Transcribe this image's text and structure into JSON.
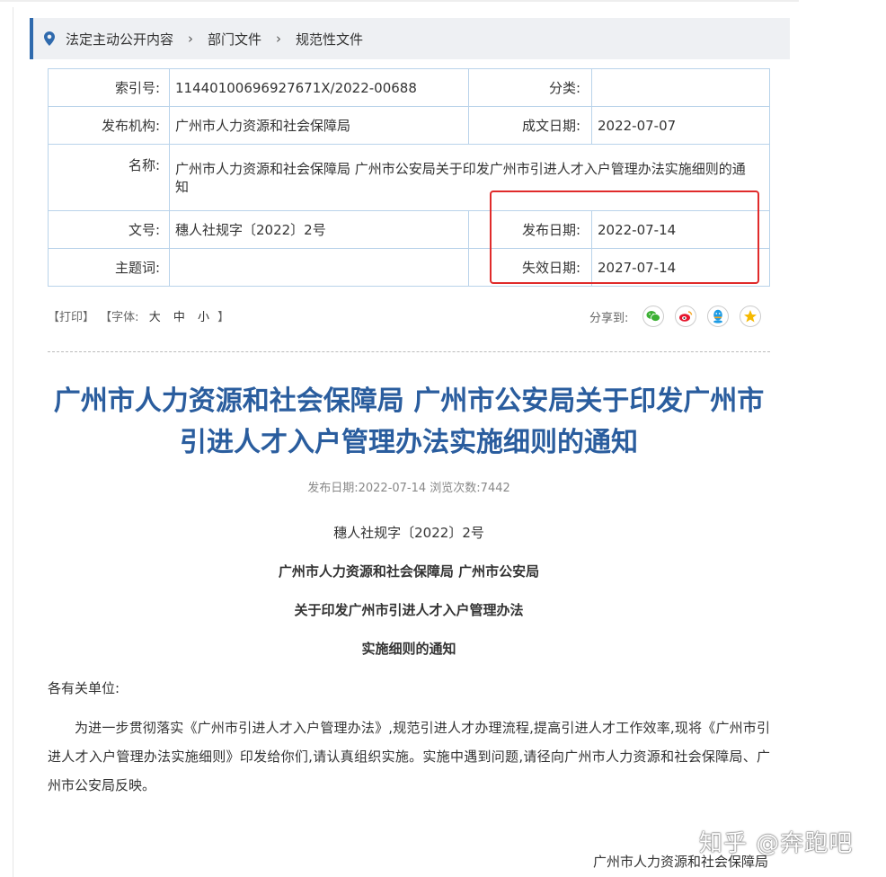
{
  "breadcrumb": [
    "法定主动公开内容",
    "部门文件",
    "规范性文件"
  ],
  "info": {
    "index_label": "索引号:",
    "index_value": "11440100696927671X/2022-00688",
    "category_label": "分类:",
    "category_value": "",
    "publisher_label": "发布机构:",
    "publisher_value": "广州市人力资源和社会保障局",
    "created_label": "成文日期:",
    "created_value": "2022-07-07",
    "name_label": "名称:",
    "name_value": "广州市人力资源和社会保障局 广州市公安局关于印发广州市引进人才入户管理办法实施细则的通知",
    "docno_label": "文号:",
    "docno_value": "穗人社规字〔2022〕2号",
    "pubdate_label": "发布日期:",
    "pubdate_value": "2022-07-14",
    "subject_label": "主题词:",
    "subject_value": "",
    "expire_label": "失效日期:",
    "expire_value": "2027-07-14"
  },
  "tools": {
    "print": "【打印】",
    "font_open": "【字体:",
    "large": "大",
    "medium": "中",
    "small": "小",
    "font_close": "】",
    "share_label": "分享到:"
  },
  "share_icons": [
    "wechat-icon",
    "weibo-icon",
    "qq-icon",
    "qzone-icon"
  ],
  "colors": {
    "accent": "#2f6aad",
    "title": "#2a5d9e",
    "table_border": "#b9d3ea",
    "highlight": "#e02b2b"
  },
  "article": {
    "title": "广州市人力资源和社会保障局 广州市公安局关于印发广州市引进人才入户管理办法实施细则的通知",
    "meta": "发布日期:2022-07-14  浏览次数:7442",
    "doc_number": "穗人社规字〔2022〕2号",
    "heading1": "广州市人力资源和社会保障局  广州市公安局",
    "heading2": "关于印发广州市引进人才入户管理办法",
    "heading3": "实施细则的通知",
    "salutation": "各有关单位:",
    "body": "为进一步贯彻落实《广州市引进人才入户管理办法》,规范引进人才办理流程,提高引进人才工作效率,现将《广州市引进人才入户管理办法实施细则》印发给你们,请认真组织实施。实施中遇到问题,请径向广州市人力资源和社会保障局、广州市公安局反映。",
    "signature": "广州市人力资源和社会保障局"
  },
  "watermark": "知乎 @奔跑吧"
}
